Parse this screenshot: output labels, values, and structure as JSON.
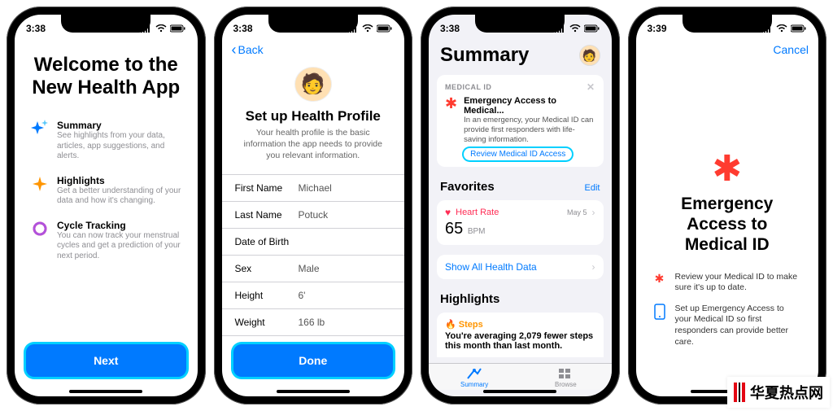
{
  "statusbar": {
    "time_a": "3:38",
    "time_b": "3:38",
    "time_c": "3:38",
    "time_d": "3:39"
  },
  "s1": {
    "title": "Welcome to the New Health App",
    "features": [
      {
        "title": "Summary",
        "desc": "See highlights from your data, articles, app suggestions, and alerts."
      },
      {
        "title": "Highlights",
        "desc": "Get a better understanding of your data and how it's changing."
      },
      {
        "title": "Cycle Tracking",
        "desc": "You can now track your menstrual cycles and get a prediction of your next period."
      }
    ],
    "next": "Next"
  },
  "s2": {
    "back": "Back",
    "title": "Set up Health Profile",
    "desc": "Your health profile is the basic information the app needs to provide you relevant information.",
    "fields": {
      "first_name_label": "First Name",
      "first_name_value": "Michael",
      "last_name_label": "Last Name",
      "last_name_value": "Potuck",
      "dob_label": "Date of Birth",
      "dob_value": "",
      "sex_label": "Sex",
      "sex_value": "Male",
      "height_label": "Height",
      "height_value": "6'",
      "weight_label": "Weight",
      "weight_value": "166 lb"
    },
    "done": "Done"
  },
  "s3": {
    "title": "Summary",
    "medical_id_header": "MEDICAL ID",
    "med_title": "Emergency Access to Medical...",
    "med_desc": "In an emergency, your Medical ID can provide first responders with life-saving information.",
    "review": "Review Medical ID Access",
    "favorites": "Favorites",
    "edit": "Edit",
    "heart_rate": "Heart Rate",
    "hr_date": "May 5",
    "hr_value": "65",
    "hr_unit": "BPM",
    "show_all": "Show All Health Data",
    "highlights": "Highlights",
    "steps": "Steps",
    "steps_body": "You're averaging 2,079 fewer steps this month than last month.",
    "tab_summary": "Summary",
    "tab_browse": "Browse"
  },
  "s4": {
    "cancel": "Cancel",
    "title": "Emergency Access to Medical ID",
    "row1": "Review your Medical ID to make sure it's up to date.",
    "row2": "Set up Emergency Access to your Medical ID so first responders can provide better care."
  },
  "watermark": "华夏热点网"
}
